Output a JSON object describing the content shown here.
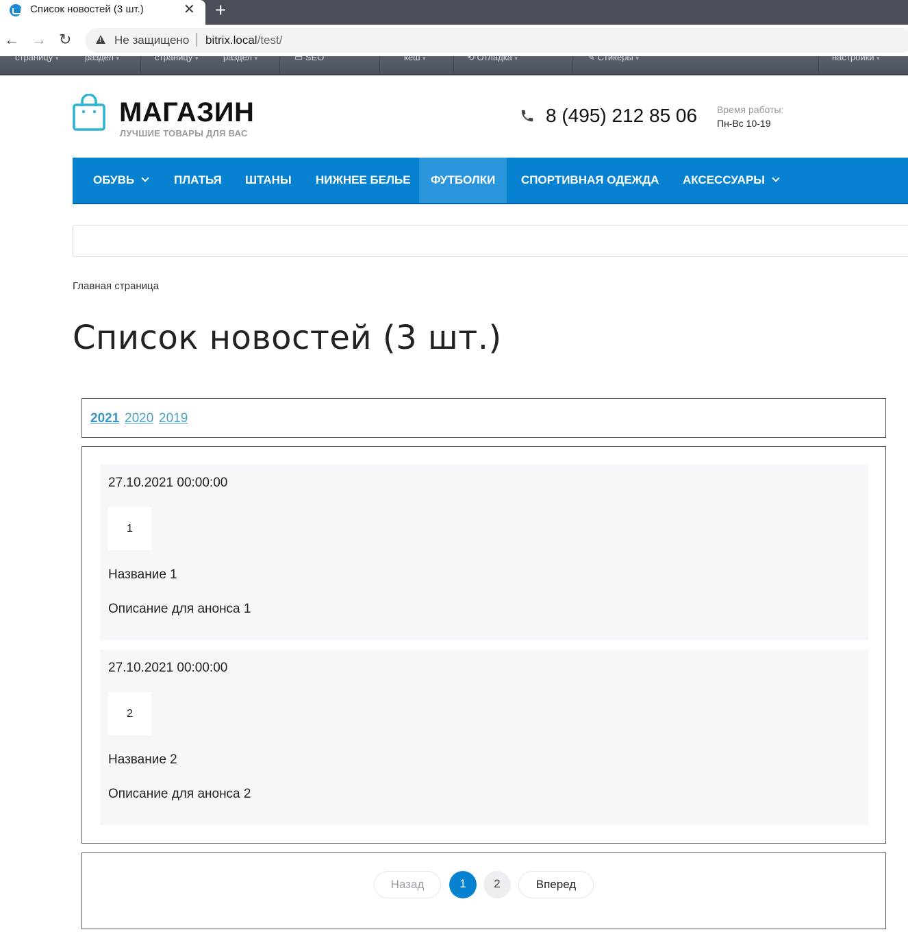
{
  "browser": {
    "tab_title": "Список новостей (3 шт.)",
    "close_glyph": "✕",
    "newtab_glyph": "+",
    "insecure_label": "Не защищено",
    "url_host": "bitrix.local",
    "url_path": "/test/",
    "back_glyph": "←",
    "forward_glyph": "→",
    "reload_glyph": "↻"
  },
  "admin_panel": {
    "items": [
      "страницу",
      "раздел",
      "страницу",
      "раздел",
      "SEO",
      "кеш",
      "Отладка",
      "Стикеры",
      "настройки"
    ]
  },
  "header": {
    "logo_title": "МАГАЗИН",
    "logo_subtitle": "ЛУЧШИЕ ТОВАРЫ ДЛЯ ВАС",
    "phone": "8 (495) 212 85 06",
    "hours_label": "Время работы:",
    "hours": "Пн-Вс 10-19",
    "accent_color": "#0782d0"
  },
  "menu": {
    "items": [
      {
        "label": "ОБУВЬ"
      },
      {
        "label": "ПЛАТЬЯ"
      },
      {
        "label": "ШТАНЫ"
      },
      {
        "label": "НИЖНЕЕ БЕЛЬЕ"
      },
      {
        "label": "ФУТБОЛКИ",
        "active": true
      },
      {
        "label": "СПОРТИВНАЯ ОДЕЖДА"
      },
      {
        "label": "АКСЕССУАРЫ"
      }
    ]
  },
  "breadcrumb": "Главная страница",
  "page_title": "Список новостей (3 шт.)",
  "years": {
    "items": [
      "2021",
      "2020",
      "2019"
    ],
    "current": "2021"
  },
  "news": [
    {
      "date": "27.10.2021 00:00:00",
      "thumb": "1",
      "name": "Название 1",
      "preview": "Описание для анонса 1"
    },
    {
      "date": "27.10.2021 00:00:00",
      "thumb": "2",
      "name": "Название 2",
      "preview": "Описание для анонса 2"
    }
  ],
  "pager": {
    "prev": "Назад",
    "pages": [
      "1",
      "2"
    ],
    "current_page": "1",
    "next": "Вперед"
  }
}
